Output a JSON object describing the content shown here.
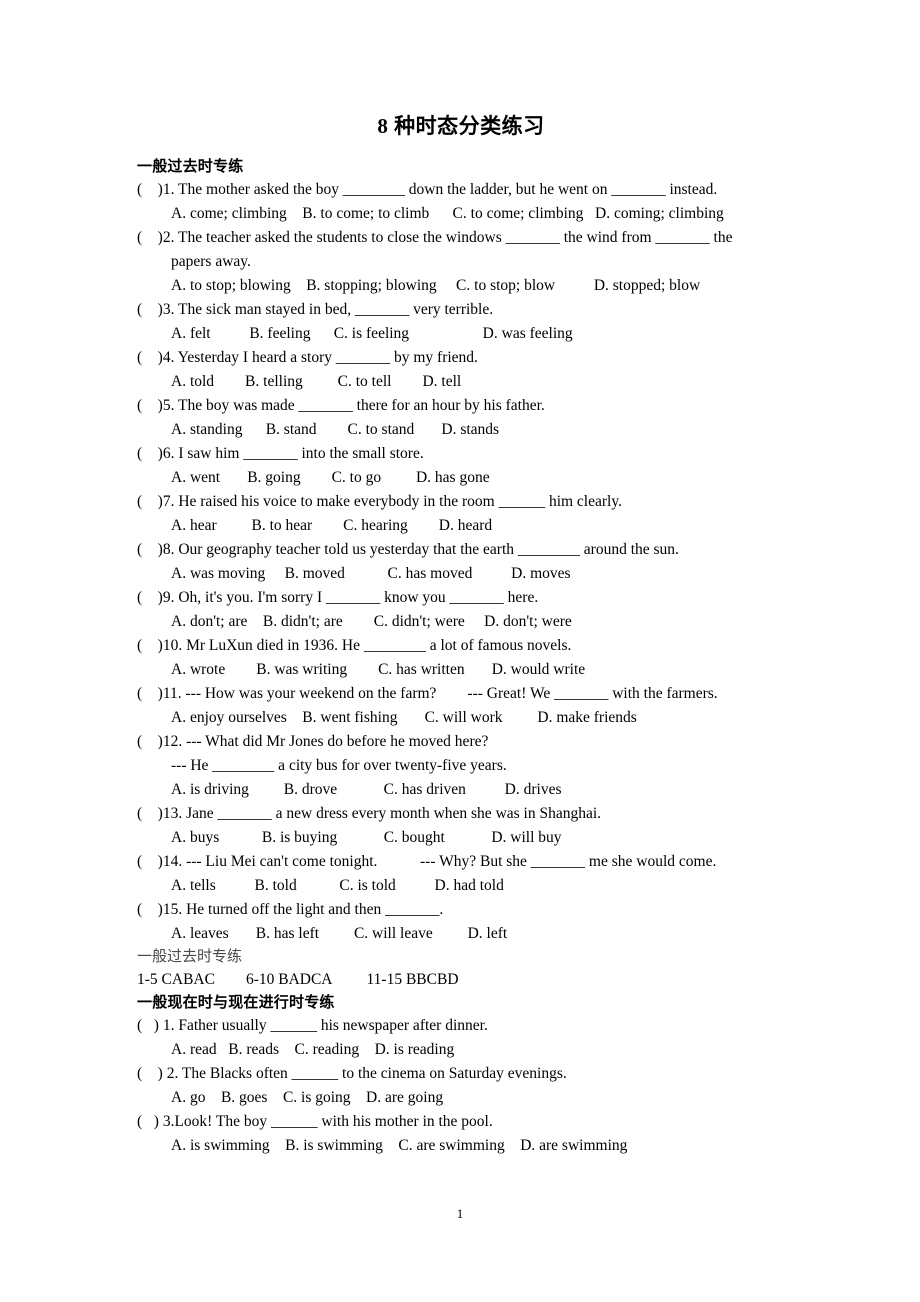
{
  "document": {
    "title": "8 种时态分类练习",
    "page_number": "1"
  },
  "sections": [
    {
      "heading": "一般过去时专练",
      "heading_style": "bold",
      "lines": [
        "(    )1. The mother asked the boy ________ down the ladder, but he went on _______ instead.",
        "A. come; climbing    B. to come; to climb      C. to come; climbing   D. coming; climbing",
        "(    )2. The teacher asked the students to close the windows _______ the wind from _______ the",
        "papers away.",
        "A. to stop; blowing    B. stopping; blowing     C. to stop; blow          D. stopped; blow",
        "(    )3. The sick man stayed in bed, _______ very terrible.",
        "A. felt          B. feeling      C. is feeling                   D. was feeling",
        "(    )4. Yesterday I heard a story _______ by my friend.",
        "A. told        B. telling         C. to tell        D. tell",
        "(    )5. The boy was made _______ there for an hour by his father.",
        "A. standing      B. stand        C. to stand       D. stands",
        "(    )6. I saw him _______ into the small store.",
        "A. went       B. going        C. to go         D. has gone",
        "(    )7. He raised his voice to make everybody in the room ______ him clearly.",
        "A. hear         B. to hear        C. hearing        D. heard",
        "(    )8. Our geography teacher told us yesterday that the earth ________ around the sun.",
        "A. was moving     B. moved           C. has moved          D. moves",
        "(    )9. Oh, it's you. I'm sorry I _______ know you _______ here.",
        "A. don't; are    B. didn't; are        C. didn't; were     D. don't; were",
        "(    )10. Mr LuXun died in 1936. He ________ a lot of famous novels.",
        "A. wrote        B. was writing        C. has written       D. would write",
        "(    )11. --- How was your weekend on the farm?        --- Great! We _______ with the farmers.",
        "A. enjoy ourselves    B. went fishing       C. will work         D. make friends",
        "(    )12. --- What did Mr Jones do before he moved here?",
        "--- He ________ a city bus for over twenty-five years.",
        "A. is driving         B. drove            C. has driven          D. drives",
        "(    )13. Jane _______ a new dress every month when she was in Shanghai.",
        "A. buys           B. is buying            C. bought            D. will buy",
        "(    )14. --- Liu Mei can't come tonight.           --- Why? But she _______ me she would come.",
        "A. tells          B. told           C. is told          D. had told",
        "(    )15. He turned off the light and then _______.",
        "A. leaves       B. has left         C. will leave         D. left"
      ],
      "line_types": [
        "q",
        "opt",
        "q",
        "cont",
        "opt",
        "q",
        "opt",
        "q",
        "opt",
        "q",
        "opt",
        "q",
        "opt",
        "q",
        "opt",
        "q",
        "opt",
        "q",
        "opt",
        "q",
        "opt",
        "q",
        "opt",
        "q",
        "cont",
        "opt",
        "q",
        "opt",
        "q",
        "opt",
        "q",
        "opt"
      ]
    },
    {
      "heading": "一般过去时专练",
      "heading_style": "light",
      "lines": [
        "1-5 CABAC        6-10 BADCA         11-15 BBCBD"
      ],
      "line_types": [
        "ans"
      ]
    },
    {
      "heading": "一般现在时与现在进行时专练",
      "heading_style": "bold",
      "lines": [
        "(   ) 1. Father usually ______ his newspaper after dinner.",
        "A. read   B. reads    C. reading    D. is reading",
        "(    ) 2. The Blacks often ______ to the cinema on Saturday evenings.",
        "A. go    B. goes    C. is going    D. are going",
        "(   ) 3.Look! The boy ______ with his mother in the pool.",
        "A. is swimming    B. is swimming    C. are swimming    D. are swimming"
      ],
      "line_types": [
        "q",
        "opt",
        "q",
        "opt",
        "q",
        "opt"
      ]
    }
  ]
}
